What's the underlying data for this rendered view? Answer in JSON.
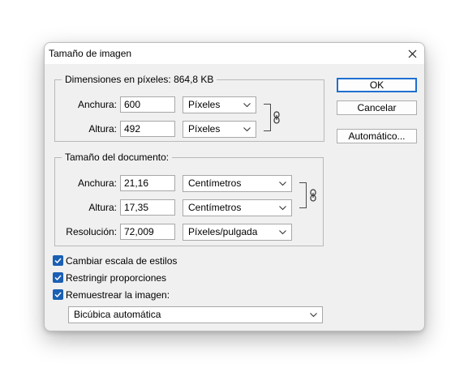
{
  "dialog": {
    "title": "Tamaño de imagen",
    "close_icon": "close-icon"
  },
  "pixel_dimensions": {
    "legend": "Dimensiones en píxeles: 864,8 KB",
    "width_label": "Anchura:",
    "width_value": "600",
    "width_unit": "Píxeles",
    "height_label": "Altura:",
    "height_value": "492",
    "height_unit": "Píxeles",
    "link_icon": "chain-link-icon"
  },
  "document_size": {
    "legend": "Tamaño del documento:",
    "width_label": "Anchura:",
    "width_value": "21,16",
    "width_unit": "Centímetros",
    "height_label": "Altura:",
    "height_value": "17,35",
    "height_unit": "Centímetros",
    "resolution_label": "Resolución:",
    "resolution_value": "72,009",
    "resolution_unit": "Píxeles/pulgada",
    "link_icon": "chain-link-icon"
  },
  "buttons": {
    "ok": "OK",
    "cancel": "Cancelar",
    "auto": "Automático..."
  },
  "options": {
    "scale_styles": {
      "label": "Cambiar escala de estilos",
      "checked": true
    },
    "constrain": {
      "label": "Restringir proporciones",
      "checked": true
    },
    "resample": {
      "label": "Remuestrear la imagen:",
      "checked": true
    },
    "resample_method": "Bicúbica automática"
  },
  "colors": {
    "accent": "#1a5fb4",
    "dialog_bg": "#f0f0f0",
    "default_button_border": "#1f6fd0"
  }
}
